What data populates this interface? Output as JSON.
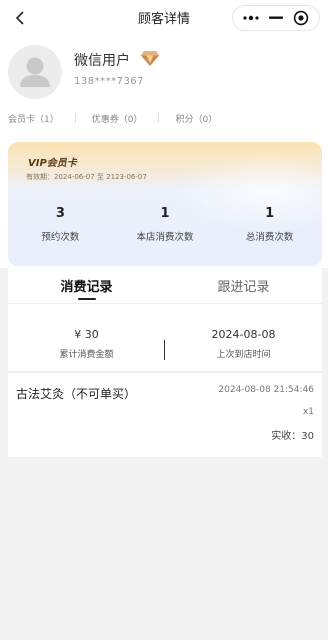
{
  "nav": {
    "title": "顾客详情",
    "icons": [
      "chevron-left-icon",
      "more-dots-icon",
      "minimize-icon",
      "target-circle-icon"
    ]
  },
  "profile": {
    "name": "微信用户",
    "phone": "138****7367",
    "badge_icon": "diamond-icon",
    "stats": [
      {
        "label": "会员卡（1）"
      },
      {
        "label": "优惠券（0）"
      },
      {
        "label": "积分（0）"
      }
    ]
  },
  "vip_card": {
    "title": "VIP会员卡",
    "validity": "有效期：2024-06-07 至 2123-06-07",
    "stats": [
      {
        "value": "3",
        "label": "预约次数"
      },
      {
        "value": "1",
        "label": "本店消费次数"
      },
      {
        "value": "1",
        "label": "总消费次数"
      }
    ]
  },
  "tabs": [
    {
      "label": "消费记录",
      "active": true
    },
    {
      "label": "跟进记录",
      "active": false
    }
  ],
  "summary": {
    "total_amount": "¥ 30",
    "total_amount_label": "累计消费金额",
    "last_visit": "2024-08-08",
    "last_visit_label": "上次到店时间"
  },
  "records": [
    {
      "name": "古法艾灸（不可单买）",
      "time": "2024-08-08 21:54:46",
      "qty": "x1",
      "paid": "实收：30"
    }
  ],
  "colors": {
    "accent_gold": "#f4d79a",
    "text_dark": "#222222",
    "background": "#f2f2f2"
  }
}
